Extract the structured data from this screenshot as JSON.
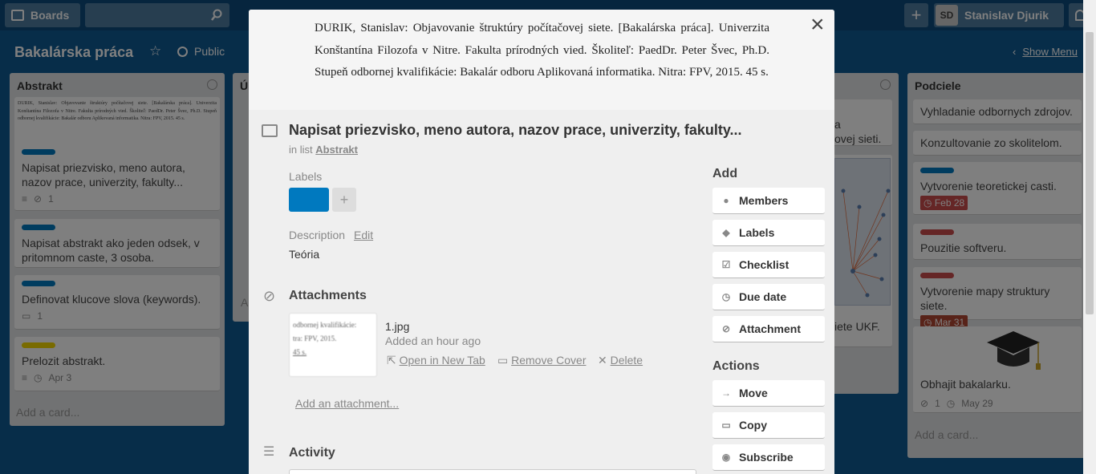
{
  "topbar": {
    "boards_label": "Boards",
    "user_initials": "SD",
    "user_name": "Stanislav Djurik"
  },
  "board": {
    "title": "Bakalárska práca",
    "visibility": "Public",
    "show_menu": "Show Menu"
  },
  "lists": [
    {
      "title": "Abstrakt",
      "add_card": "Add a card...",
      "cover_text": "DURIK, Stanislav: Objavovanie štruktúry počítačovej siete. [Bakalárska práca]. Univerzita Konštantína Filozofa v Nitre. Fakulta prírodných vied. Školiteľ: PaedDr. Peter Švec, Ph.D. Stupeň odbornej kvalifikácie: Bakalár odboru Aplikovaná informatika. Nitra: FPV, 2015. 45 s.",
      "cards": [
        {
          "title": "Napisat priezvisko, meno autora, nazov prace, univerzity, fakulty...",
          "label_color": "#0079bf",
          "attachments": "1"
        },
        {
          "title": "Napisat abstrakt ako jeden odsek, v pritomnom caste, 3 osoba.",
          "label_color": "#0079bf"
        },
        {
          "title": "Definovat klucove slova (keywords).",
          "label_color": "#0079bf",
          "comments": "1"
        },
        {
          "title": "Prelozit abstrakt.",
          "label_color": "#f2d600",
          "due": "Apr 3"
        }
      ]
    },
    {
      "title_partial": "Ú",
      "add_partial": "A"
    },
    {
      "frag_1": "a",
      "frag_2": "ovej sieti.",
      "frag_3": "iete UKF."
    },
    {
      "title": "Podciele",
      "add_card": "Add a card...",
      "cards": [
        {
          "title": "Vyhladanie odbornych zdrojov."
        },
        {
          "title": "Konzultovanie zo skolitelom."
        },
        {
          "title": "Vytvorenie teoretickej casti.",
          "label_color": "#0079bf",
          "due": "Feb 28",
          "due_color": "#cb4d4d"
        },
        {
          "title": "Pouzitie softveru.",
          "label_color": "#cb4d4d"
        },
        {
          "title": "Vytvorenie mapy struktury siete.",
          "label_color": "#cb4d4d",
          "due": "Mar 31",
          "due_color": "#b04632"
        },
        {
          "title": "Obhajit bakalarku.",
          "attachments": "1",
          "due": "May 29"
        }
      ]
    }
  ],
  "modal": {
    "title": "Napisat priezvisko, meno autora, nazov prace, univerzity, fakulty...",
    "in_list_prefix": "in list",
    "in_list_name": "Abstrakt",
    "labels_heading": "Labels",
    "label_color": "#0079bf",
    "label_add": "+",
    "description_heading": "Description",
    "description_edit": "Edit",
    "description": "Teória",
    "attachments_heading": "Attachments",
    "attachment": {
      "filename": "1.jpg",
      "added": "Added an hour ago",
      "open": "Open in New Tab",
      "remove_cover": "Remove Cover",
      "delete": "Delete",
      "thumb_lines": [
        "odbornej kvalifikácie:",
        "tra: FPV, 2015.",
        "45 s."
      ]
    },
    "add_attachment": "Add an attachment...",
    "activity_heading": "Activity",
    "add_heading": "Add",
    "actions_heading": "Actions",
    "add_buttons": [
      "Members",
      "Labels",
      "Checklist",
      "Due date",
      "Attachment"
    ],
    "action_buttons": [
      "Move",
      "Copy",
      "Subscribe"
    ],
    "close": "×"
  }
}
